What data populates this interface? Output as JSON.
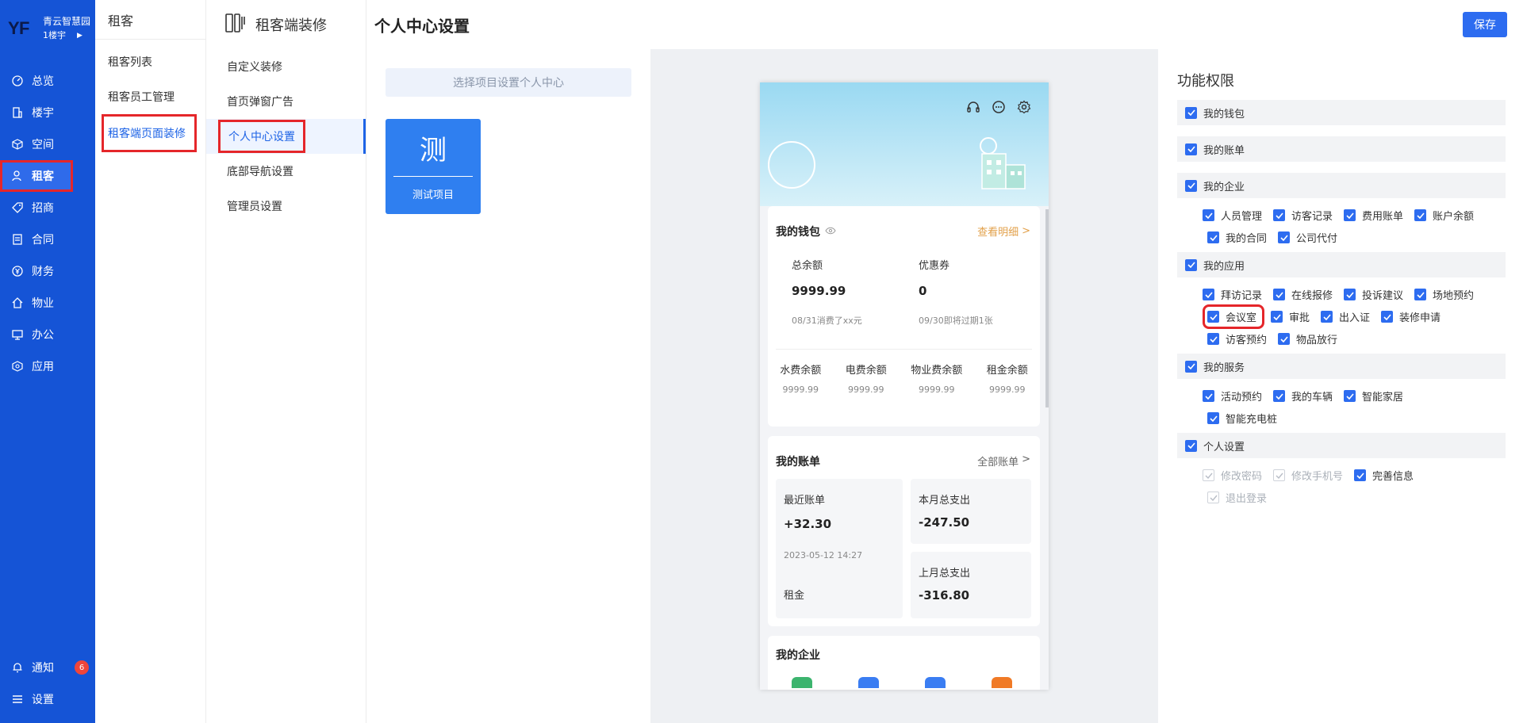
{
  "brand": {
    "name": "青云智慧园",
    "building": "1楼宇"
  },
  "nav": {
    "items": [
      {
        "label": "总览",
        "icon": "dashboard-icon"
      },
      {
        "label": "楼宇",
        "icon": "building-icon"
      },
      {
        "label": "空间",
        "icon": "cube-icon"
      },
      {
        "label": "租客",
        "icon": "tenant-icon"
      },
      {
        "label": "招商",
        "icon": "tag-icon"
      },
      {
        "label": "合同",
        "icon": "document-icon"
      },
      {
        "label": "财务",
        "icon": "yen-icon"
      },
      {
        "label": "物业",
        "icon": "home-icon"
      },
      {
        "label": "办公",
        "icon": "monitor-icon"
      },
      {
        "label": "应用",
        "icon": "box-icon"
      }
    ],
    "bottom": [
      {
        "label": "通知",
        "icon": "bell-icon",
        "badge": "6"
      },
      {
        "label": "设置",
        "icon": "menu-icon"
      }
    ]
  },
  "col2": {
    "title": "租客",
    "items": [
      "租客列表",
      "租客员工管理",
      "租客端页面装修"
    ]
  },
  "col3": {
    "title": "租客端装修",
    "items": [
      "自定义装修",
      "首页弹窗广告",
      "个人中心设置",
      "底部导航设置",
      "管理员设置"
    ]
  },
  "header": {
    "title": "个人中心设置",
    "save_label": "保存"
  },
  "project": {
    "select_placeholder": "选择项目设置个人中心",
    "card_char": "测",
    "card_name": "测试项目"
  },
  "phone": {
    "wallet": {
      "title": "我的钱包",
      "link": "查看明细",
      "total_label": "总余额",
      "total_value": "9999.99",
      "total_note": "08/31消费了xx元",
      "coupon_label": "优惠券",
      "coupon_value": "0",
      "coupon_note": "09/30即将过期1张",
      "balances": [
        {
          "label": "水费余额",
          "value": "9999.99"
        },
        {
          "label": "电费余额",
          "value": "9999.99"
        },
        {
          "label": "物业费余额",
          "value": "9999.99"
        },
        {
          "label": "租金余额",
          "value": "9999.99"
        }
      ]
    },
    "bill": {
      "title": "我的账单",
      "link": "全部账单",
      "recent_label": "最近账单",
      "recent_value": "+32.30",
      "recent_date": "2023-05-12 14:27",
      "recent_type": "租金",
      "month_label": "本月总支出",
      "month_value": "-247.50",
      "last_label": "上月总支出",
      "last_value": "-316.80"
    },
    "enterprise": {
      "title": "我的企业"
    }
  },
  "permissions": {
    "title": "功能权限",
    "groups": {
      "wallet": "我的钱包",
      "bill": "我的账单",
      "enterprise": "我的企业",
      "app": "我的应用",
      "service": "我的服务",
      "personal": "个人设置"
    },
    "enterprise_items": [
      "人员管理",
      "访客记录",
      "费用账单",
      "账户余额",
      "我的合同",
      "公司代付"
    ],
    "app_items": [
      "拜访记录",
      "在线报修",
      "投诉建议",
      "场地预约",
      "会议室",
      "审批",
      "出入证",
      "装修申请",
      "访客预约",
      "物品放行"
    ],
    "service_items": [
      "活动预约",
      "我的车辆",
      "智能家居",
      "智能充电桩"
    ],
    "personal_items": [
      "修改密码",
      "修改手机号",
      "完善信息",
      "退出登录"
    ]
  },
  "colors": {
    "nav_bg": "#1554d6",
    "accent": "#2d6cf0",
    "highlight": "#e5262a"
  }
}
